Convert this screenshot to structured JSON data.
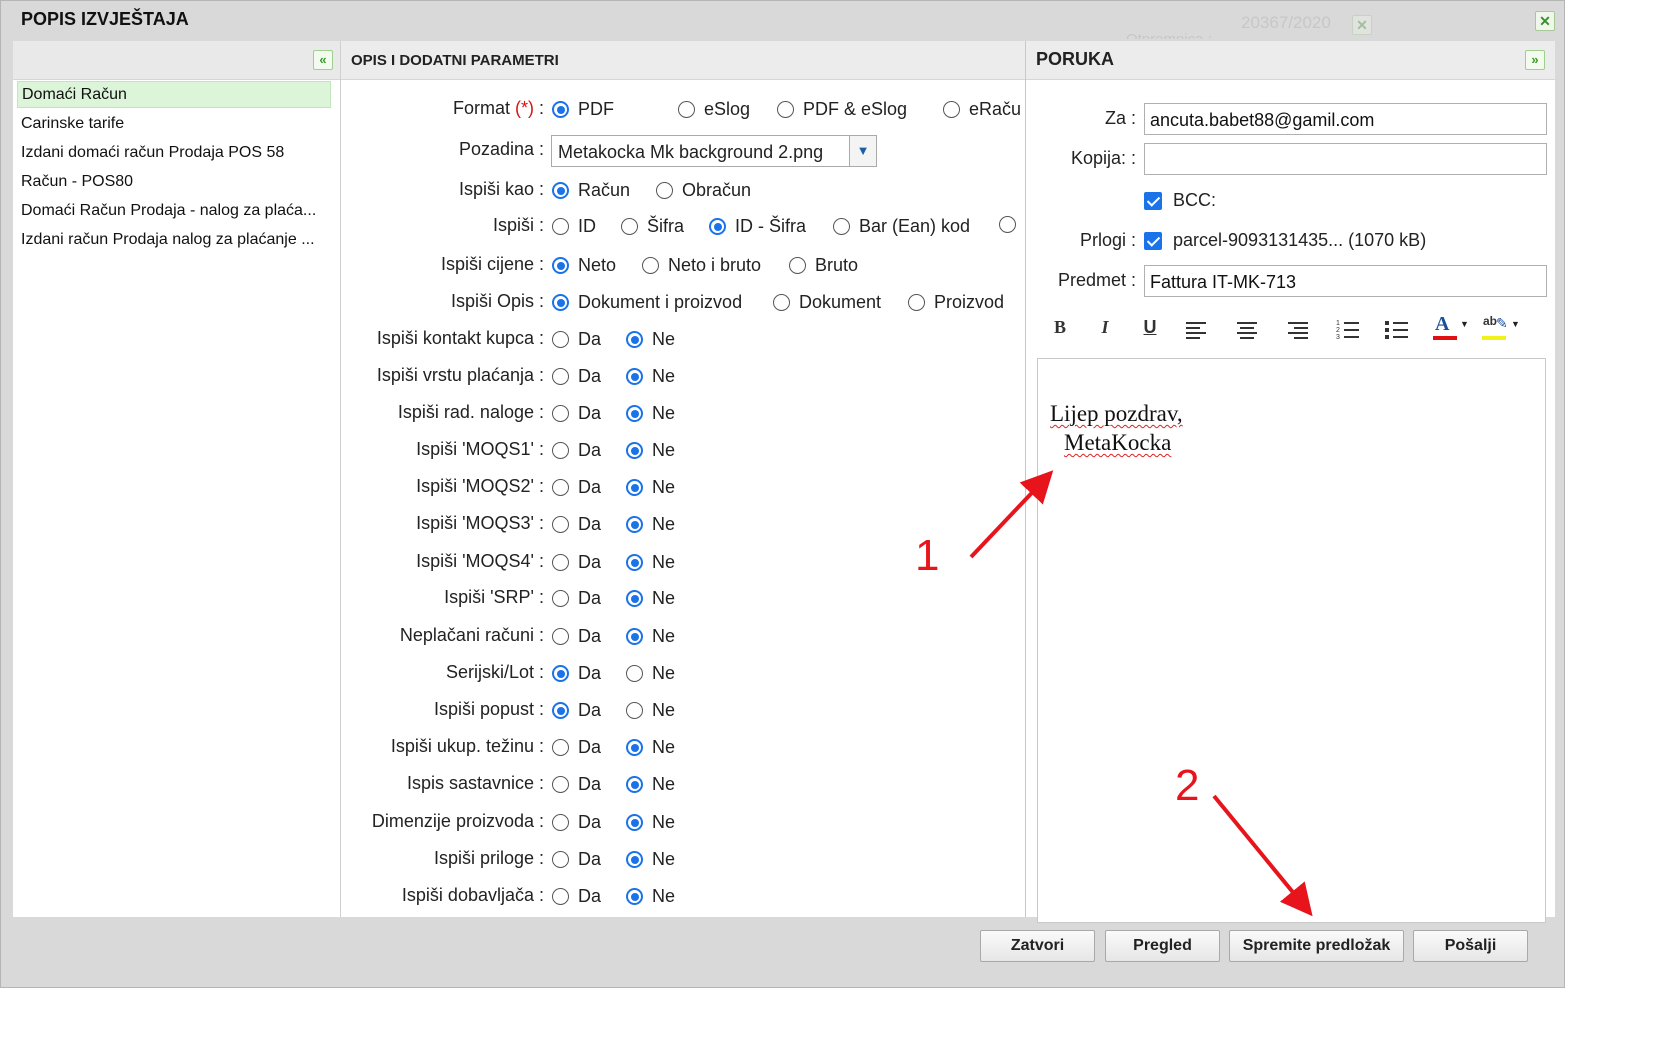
{
  "dialog": {
    "title": "POPIS IZVJEŠTAJA",
    "ghost_number": "20367/2020",
    "ghost_text": "Otpremnica :",
    "close_glyph": "✕"
  },
  "reports_panel": {
    "collapse_glyph": "«",
    "items": [
      {
        "label": "Domaći Račun",
        "selected": true
      },
      {
        "label": "Carinske tarife",
        "selected": false
      },
      {
        "label": "Izdani domaći račun Prodaja POS 58",
        "selected": false
      },
      {
        "label": "Račun - POS80",
        "selected": false
      },
      {
        "label": "Domaći Račun Prodaja - nalog za plaća...",
        "selected": false
      },
      {
        "label": "Izdani račun Prodaja nalog za plaćanje ...",
        "selected": false
      }
    ]
  },
  "params_panel": {
    "title": "OPIS I DODATNI PARAMETRI",
    "format": {
      "label": "Format",
      "req": "(*)",
      "colon": " :",
      "options": [
        "PDF",
        "eSlog",
        "PDF & eSlog",
        "eRaču"
      ],
      "selected": 0
    },
    "pozadina": {
      "label": "Pozadina :",
      "value": "Metakocka Mk background 2.png"
    },
    "ispisi_kao": {
      "label": "Ispiši kao :",
      "options": [
        "Račun",
        "Obračun"
      ],
      "selected": 0
    },
    "ispisi": {
      "label": "Ispiši :",
      "options": [
        "ID",
        "Šifra",
        "ID - Šifra",
        "Bar (Ean) kod",
        ""
      ],
      "selected": 2
    },
    "cijene": {
      "label": "Ispiši cijene :",
      "options": [
        "Neto",
        "Neto i bruto",
        "Bruto"
      ],
      "selected": 0
    },
    "opis": {
      "label": "Ispiši Opis :",
      "options": [
        "Dokument i proizvod",
        "Dokument",
        "Proizvod"
      ],
      "selected": 0
    },
    "yesno_rows": [
      {
        "label": "Ispiši kontakt kupca :",
        "da": "Da",
        "ne": "Ne",
        "selected": "ne"
      },
      {
        "label": "Ispiši vrstu plaćanja :",
        "da": "Da",
        "ne": "Ne",
        "selected": "ne"
      },
      {
        "label": "Ispiši rad. naloge :",
        "da": "Da",
        "ne": "Ne",
        "selected": "ne"
      },
      {
        "label": "Ispiši 'MOQS1' :",
        "da": "Da",
        "ne": "Ne",
        "selected": "ne"
      },
      {
        "label": "Ispiši 'MOQS2' :",
        "da": "Da",
        "ne": "Ne",
        "selected": "ne"
      },
      {
        "label": "Ispiši 'MOQS3' :",
        "da": "Da",
        "ne": "Ne",
        "selected": "ne"
      },
      {
        "label": "Ispiši 'MOQS4' :",
        "da": "Da",
        "ne": "Ne",
        "selected": "ne"
      },
      {
        "label": "Ispiši 'SRP' :",
        "da": "Da",
        "ne": "Ne",
        "selected": "ne"
      },
      {
        "label": "Neplačani računi :",
        "da": "Da",
        "ne": "Ne",
        "selected": "ne"
      },
      {
        "label": "Serijski/Lot :",
        "da": "Da",
        "ne": "Ne",
        "selected": "da"
      },
      {
        "label": "Ispiši popust :",
        "da": "Da",
        "ne": "Ne",
        "selected": "da"
      },
      {
        "label": "Ispiši ukup. težinu :",
        "da": "Da",
        "ne": "Ne",
        "selected": "ne"
      },
      {
        "label": "Ispis sastavnice :",
        "da": "Da",
        "ne": "Ne",
        "selected": "ne"
      },
      {
        "label": "Dimenzije proizvoda :",
        "da": "Da",
        "ne": "Ne",
        "selected": "ne"
      },
      {
        "label": "Ispiši priloge :",
        "da": "Da",
        "ne": "Ne",
        "selected": "ne"
      },
      {
        "label": "Ispiši dobavljača :",
        "da": "Da",
        "ne": "Ne",
        "selected": "ne"
      }
    ]
  },
  "message_panel": {
    "title": "PORUKA",
    "expand_glyph": "»",
    "za_label": "Za :",
    "za_value": "ancuta.babet88@gamil.com",
    "kopija_label": "Kopija: :",
    "kopija_value": "",
    "bcc_label": "BCC:",
    "bcc_checked": true,
    "prilogi_label": "Prlogi :",
    "prilogi_value": "parcel-9093131435... (1070 kB)",
    "prilogi_checked": true,
    "predmet_label": "Predmet :",
    "predmet_value": "Fattura IT-MK-713",
    "toolbar": {
      "bold": "B",
      "italic": "I",
      "underline": "U",
      "align_left_icon": "align-left-icon",
      "align_center_icon": "align-center-icon",
      "align_right_icon": "align-right-icon",
      "ordered_list_icon": "ordered-list-icon",
      "bullet_list_icon": "bullet-list-icon",
      "text_color_glyph": "A",
      "highlight_glyph": "ab"
    },
    "body_line1": "Lijep pozdrav,",
    "body_line2": "MetaKocka"
  },
  "buttons": {
    "close": "Zatvori",
    "preview": "Pregled",
    "save_template": "Spremite predložak",
    "send": "Pošalji"
  },
  "annotations": {
    "one": "1",
    "two": "2"
  },
  "colors": {
    "accent": "#1a73e8",
    "annotation": "#e8141b",
    "selected_row": "#dcf4d8"
  }
}
